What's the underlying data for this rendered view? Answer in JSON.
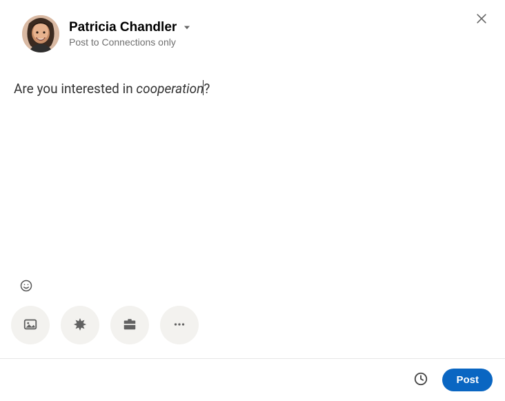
{
  "header": {
    "user_name": "Patricia Chandler",
    "audience_label": "Post to Connections only"
  },
  "composer": {
    "text_plain_prefix": "Are you interested in ",
    "text_italic": "cooperation",
    "text_plain_suffix": "?"
  },
  "icons": {
    "close": "close-icon",
    "caret": "chevron-down-icon",
    "emoji": "emoji-icon",
    "image": "image-icon",
    "starburst": "starburst-icon",
    "briefcase": "briefcase-icon",
    "more": "more-icon",
    "clock": "clock-icon"
  },
  "footer": {
    "post_label": "Post"
  },
  "colors": {
    "primary": "#0a66c2",
    "chip_bg": "#f3f2ef",
    "muted_text": "#6e6e6e"
  }
}
